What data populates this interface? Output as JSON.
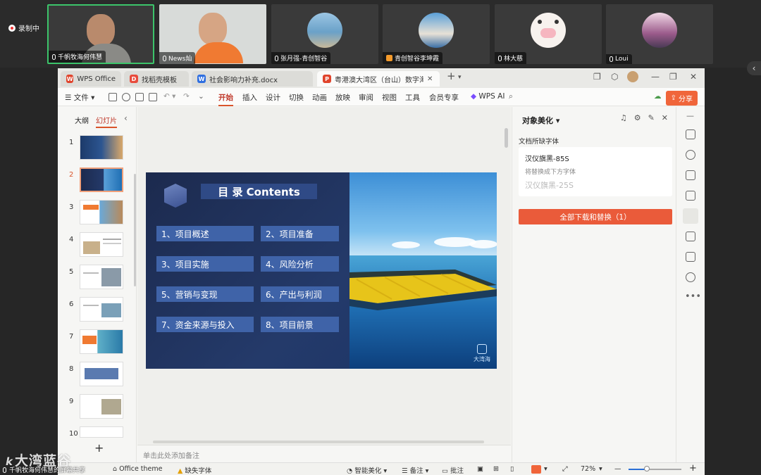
{
  "meeting": {
    "recording_label": "录制中",
    "participants": [
      {
        "name": "千帆牧海何伟慧"
      },
      {
        "name": "News灿"
      },
      {
        "name": "张月强-青创智谷"
      },
      {
        "name": "青创智谷李坤霞"
      },
      {
        "name": "林大慈"
      },
      {
        "name": "Loui"
      }
    ],
    "sharer_label": "千帆牧海何伟慧的屏幕共享"
  },
  "watermark": {
    "logo": "k",
    "text": "大湾蓝谷"
  },
  "tabs": [
    {
      "label": "WPS Office",
      "icon": "W"
    },
    {
      "label": "找稻壳模板",
      "icon": "D"
    },
    {
      "label": "社会影响力补充.docx",
      "icon": "W"
    },
    {
      "label": "粤港澳大湾区（台山）数字海洋牧",
      "icon": "P"
    }
  ],
  "ribbon": {
    "file_menu": "文件",
    "items": [
      "开始",
      "插入",
      "设计",
      "切换",
      "动画",
      "放映",
      "审阅",
      "视图",
      "工具",
      "会员专享"
    ],
    "wps_ai": "WPS AI",
    "share": "分享"
  },
  "slide_panel": {
    "tab_outline": "大纲",
    "tab_slides": "幻灯片",
    "slides": [
      "1",
      "2",
      "3",
      "4",
      "5",
      "6",
      "7",
      "8",
      "9",
      "10"
    ],
    "current": 2
  },
  "slide": {
    "title": "目 录 Contents",
    "items": [
      "1、项目概述",
      "2、项目准备",
      "3、项目实施",
      "4、风险分析",
      "5、营销与变现",
      "6、产出与利润",
      "7、资金来源与投入",
      "8、项目前景"
    ],
    "logo_text": "大湾海"
  },
  "notes_placeholder": "单击此处添加备注",
  "right_pane": {
    "title": "对象美化",
    "missing_fonts_label": "文档所缺字体",
    "missing_font": "汉仪旗黑-85S",
    "replace_hint": "将替换成下方字体",
    "replacement_font": "汉仪旗黑-25S",
    "download_button": "全部下载和替换（1）"
  },
  "status": {
    "theme": "Office theme",
    "missing_font": "缺失字体",
    "smart_beautify": "智能美化",
    "notes": "备注",
    "comments": "批注",
    "zoom": "72%",
    "zoom_fraction": 0.35
  },
  "colors": {
    "accent": "#d9542b",
    "slide_bg": "#1c2a4e",
    "slide_item": "#3f63a8"
  }
}
